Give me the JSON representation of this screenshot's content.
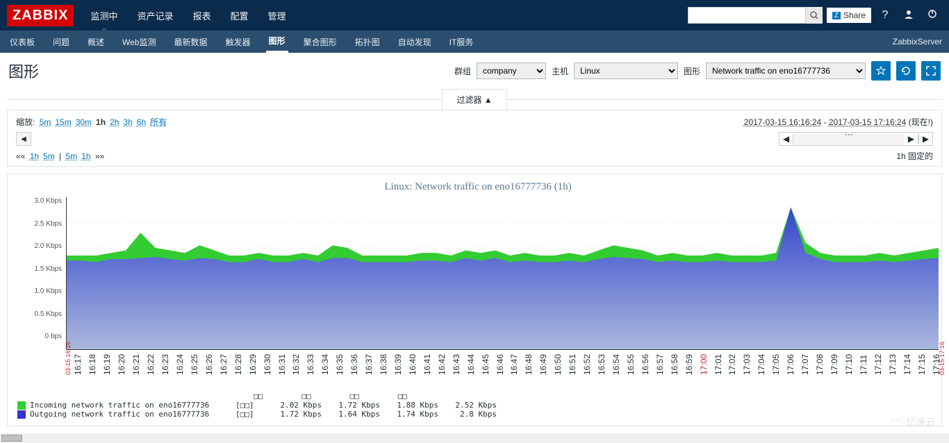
{
  "logo": "ZABBIX",
  "topnav": [
    "监测中",
    "资产记录",
    "报表",
    "配置",
    "管理"
  ],
  "topnav_active": 0,
  "share_label": "Share",
  "subnav": [
    "仪表板",
    "问题",
    "概述",
    "Web监测",
    "最新数据",
    "触发器",
    "图形",
    "聚合图形",
    "拓扑图",
    "自动发现",
    "IT服务"
  ],
  "subnav_active": 6,
  "sub_right": "ZabbixServer",
  "page_title": "图形",
  "selector_group_label": "群组",
  "selector_group_value": "company",
  "selector_host_label": "主机",
  "selector_host_value": "Linux",
  "selector_graph_label": "图形",
  "selector_graph_value": "Network traffic on eno16777736",
  "filter_tab": "过滤器 ▲",
  "zoom_label": "缩放:",
  "zoom_options": [
    "5m",
    "15m",
    "30m",
    "1h",
    "2h",
    "3h",
    "6h",
    "所有"
  ],
  "zoom_active": 3,
  "time_from": "2017-03-15 16:16:24",
  "time_to": "2017-03-15 17:16:24",
  "time_now": "(现在!)",
  "quick_left": [
    "1h",
    "5m"
  ],
  "quick_right": [
    "5m",
    "1h"
  ],
  "fixed_label": "1h  固定的",
  "chart_data": {
    "type": "area",
    "title": "Linux: Network traffic on eno16777736 (1h)",
    "ylabel": "",
    "ylim": [
      0,
      3.0
    ],
    "yticks": [
      "3.0 Kbps",
      "2.5 Kbps",
      "2.0 Kbps",
      "1.5 Kbps",
      "1.0 Kbps",
      "0.5 Kbps",
      "0 bps"
    ],
    "x_edge_start": "03-15 16:16",
    "x_edge_end": "03-15 17:16",
    "xticks": [
      "16:17",
      "16:18",
      "16:19",
      "16:20",
      "16:21",
      "16:22",
      "16:23",
      "16:24",
      "16:25",
      "16:26",
      "16:27",
      "16:28",
      "16:29",
      "16:30",
      "16:31",
      "16:32",
      "16:33",
      "16:34",
      "16:35",
      "16:36",
      "16:37",
      "16:38",
      "16:39",
      "16:40",
      "16:41",
      "16:42",
      "16:43",
      "16:44",
      "16:45",
      "16:46",
      "16:47",
      "16:48",
      "16:49",
      "16:50",
      "16:51",
      "16:52",
      "16:53",
      "16:54",
      "16:55",
      "16:56",
      "16:57",
      "16:58",
      "16:59",
      "17:00",
      "17:01",
      "17:02",
      "17:03",
      "17:04",
      "17:05",
      "17:06",
      "17:07",
      "17:08",
      "17:09",
      "17:10",
      "17:11",
      "17:12",
      "17:13",
      "17:14",
      "17:15",
      "17:16"
    ],
    "xtick_red": "17:00",
    "series": [
      {
        "name": "Incoming network traffic on eno16777736",
        "color": "#33cc33",
        "unit": "[□□]",
        "values": [
          1.85,
          1.85,
          1.85,
          1.9,
          1.95,
          2.3,
          2.0,
          1.95,
          1.9,
          2.05,
          1.95,
          1.85,
          1.85,
          1.9,
          1.85,
          1.85,
          1.9,
          1.85,
          2.05,
          2.0,
          1.85,
          1.85,
          1.85,
          1.85,
          1.9,
          1.9,
          1.85,
          1.95,
          1.9,
          1.95,
          1.85,
          1.9,
          1.85,
          1.85,
          1.9,
          1.85,
          1.95,
          2.05,
          2.0,
          1.95,
          1.85,
          1.9,
          1.85,
          1.85,
          1.9,
          1.85,
          1.85,
          1.85,
          1.9,
          2.8,
          2.1,
          1.9,
          1.85,
          1.85,
          1.85,
          1.9,
          1.85,
          1.9,
          1.95,
          2.0
        ],
        "stats": {
          "last": "2.02 Kbps",
          "min": "1.72 Kbps",
          "avg": "1.88 Kbps",
          "max": "2.52 Kbps"
        }
      },
      {
        "name": "Outgoing network traffic on eno16777736",
        "color": "#3333cc",
        "unit": "[□□]",
        "values": [
          1.75,
          1.75,
          1.72,
          1.78,
          1.78,
          1.8,
          1.82,
          1.78,
          1.75,
          1.8,
          1.78,
          1.72,
          1.72,
          1.78,
          1.72,
          1.72,
          1.78,
          1.72,
          1.8,
          1.8,
          1.72,
          1.72,
          1.72,
          1.72,
          1.75,
          1.75,
          1.72,
          1.8,
          1.75,
          1.8,
          1.72,
          1.75,
          1.72,
          1.72,
          1.75,
          1.72,
          1.78,
          1.82,
          1.8,
          1.78,
          1.72,
          1.75,
          1.72,
          1.72,
          1.75,
          1.72,
          1.72,
          1.72,
          1.75,
          2.8,
          1.9,
          1.78,
          1.72,
          1.72,
          1.72,
          1.75,
          1.72,
          1.75,
          1.78,
          1.8
        ],
        "stats": {
          "last": "1.72 Kbps",
          "min": "1.64 Kbps",
          "avg": "1.74 Kbps",
          "max": "2.8 Kbps"
        }
      }
    ],
    "legend_headers": [
      "□□",
      "□□",
      "□□",
      "□□"
    ]
  },
  "watermark": "亿速云"
}
